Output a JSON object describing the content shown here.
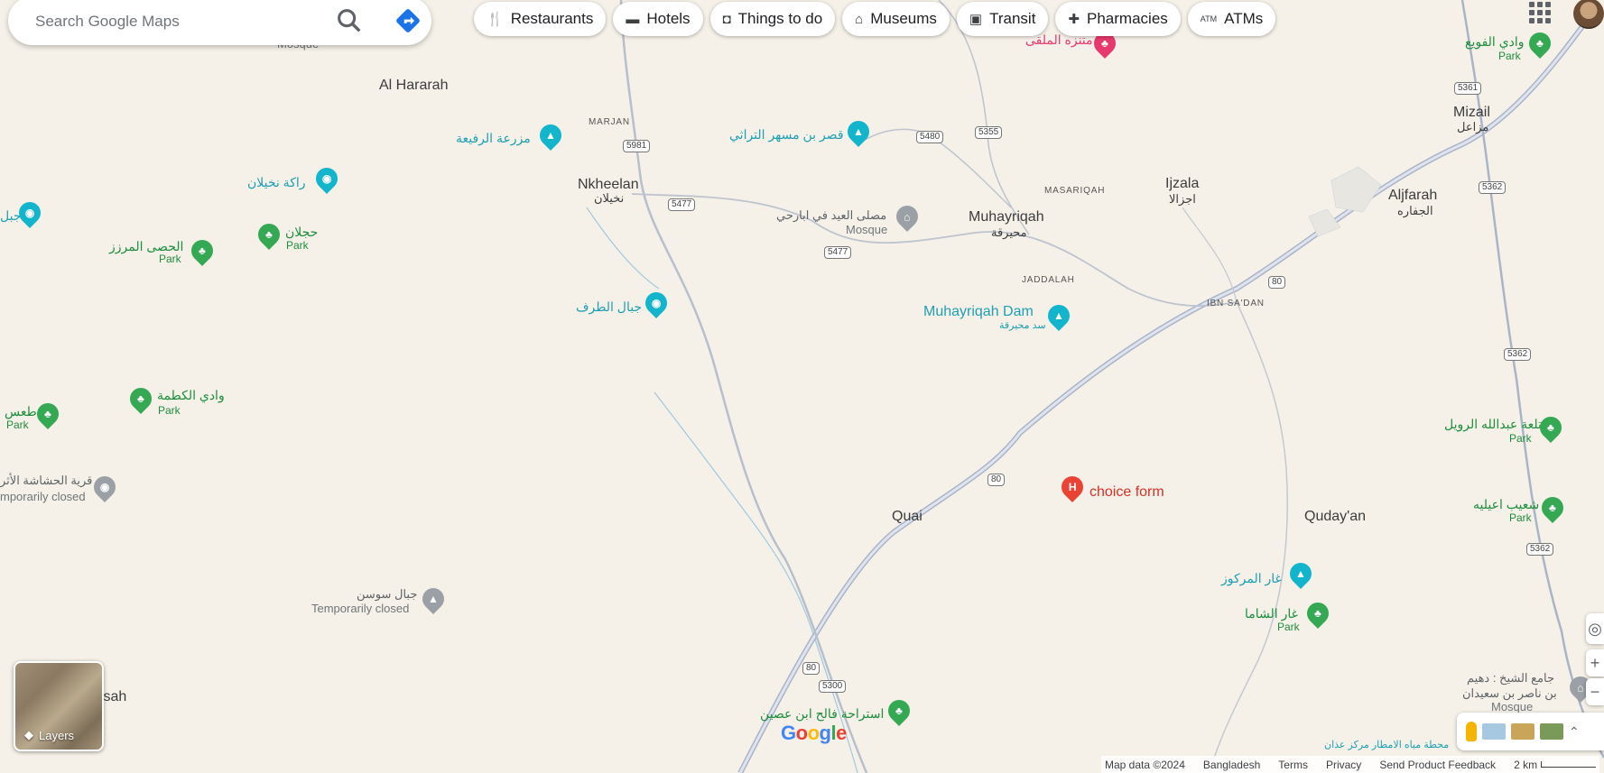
{
  "search": {
    "placeholder": "Search Google Maps"
  },
  "chips": [
    {
      "icon": "fork-knife-icon",
      "label": "Restaurants"
    },
    {
      "icon": "bed-icon",
      "label": "Hotels"
    },
    {
      "icon": "camera-icon",
      "label": "Things to do"
    },
    {
      "icon": "museum-icon",
      "label": "Museums"
    },
    {
      "icon": "train-icon",
      "label": "Transit"
    },
    {
      "icon": "pharmacy-icon",
      "label": "Pharmacies"
    },
    {
      "icon": "atm-icon",
      "label": "ATMs"
    }
  ],
  "towns": {
    "al_hararah": "Al Hararah",
    "nkheelan": "Nkheelan",
    "nkheelan_ar": "نخيلان",
    "muhayriqah": "Muhayriqah",
    "muhayriqah_ar": "محيرقة",
    "ijzala": "Ijzala",
    "ijzala_ar": "اجزالا",
    "aljfarah": "Aljfarah",
    "aljfarah_ar": "الجفاره",
    "mizail": "Mizail",
    "mizail_ar": "مزاعل",
    "quai": "Quai",
    "qudayan": "Quday'an",
    "afsah": "fsah"
  },
  "areas": {
    "marjan": "MARJAN",
    "masariqah": "MASARIQAH",
    "jaddalah": "JADDALAH",
    "ibn_sadan": "IBN SA'DAN"
  },
  "roads": [
    "5981",
    "5477",
    "5477",
    "5480",
    "5355",
    "5361",
    "5362",
    "5362",
    "5362",
    "80",
    "80",
    "80",
    "5300"
  ],
  "pois": {
    "farm": "مزرعة الرفيعة",
    "qasr": "قصر بن مسهر التراثي",
    "rakah": "راكة نخيلان",
    "jebel_edge": "جبل",
    "musalla": "مصلى العيد في ابارحي",
    "musalla_type": "Mosque",
    "jebal_taraf": "جبال الطرف",
    "dam": "Muhayriqah Dam",
    "dam_ar": "سد محيرقة",
    "choice_form": "choice form",
    "ghar_markooz": "غار المركوز",
    "ghar_shama": "غار الشاما",
    "qaryat": "قرية الحشاشة الأثر",
    "qaryat_status": "mporarily closed",
    "jebal_sawsan": "جبال سوسن",
    "jebal_sawsan_status": "Temporarily closed",
    "istiraha": "استراحة فالح ابن عصين",
    "masjid_top": "Mosque",
    "mutanazzah": "متنزه الملقى",
    "jami": "جامع الشيخ : دهيم",
    "jami_2": "بن ناصر بن سعيدان",
    "jami_type": "Mosque",
    "miyah": "محطة مياه الامطار مركز عذان"
  },
  "parks": {
    "hasa": "الحصى المرزز",
    "hajlan": "حجلان",
    "tas": "طعس",
    "wadi_kadma": "وادي الكطمة",
    "ghar_shama_park": "Park",
    "wadi_fawa": "وادي الفويع",
    "talat": "تلعة عبدالله الرويل",
    "shaib": "شعيب اعيليه",
    "park_word": "Park"
  },
  "layers": {
    "label": "Layers"
  },
  "footer": {
    "map_data": "Map data ©2024",
    "country": "Bangladesh",
    "terms": "Terms",
    "privacy": "Privacy",
    "feedback": "Send Product Feedback",
    "scale": "2 km"
  },
  "logo": "Google",
  "colors": {
    "bg": "#f5f1e8",
    "road": "#aab4c8",
    "water": "#9fc9e0",
    "teal": "#12b5cb",
    "green": "#34a853"
  }
}
